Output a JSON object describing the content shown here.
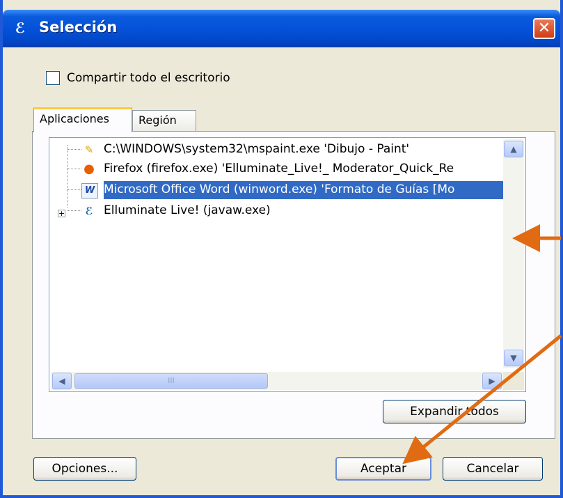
{
  "window": {
    "title": "Selección",
    "close_glyph": "✕"
  },
  "share_desktop": {
    "label": "Compartir todo el escritorio",
    "checked": false
  },
  "tabs": [
    {
      "label": "Aplicaciones",
      "active": true
    },
    {
      "label": "Región",
      "active": false
    }
  ],
  "tree": {
    "items": [
      {
        "label": "C:\\WINDOWS\\system32\\mspaint.exe 'Dibujo - Paint'",
        "icon": "paint-icon",
        "selected": false
      },
      {
        "label": "Firefox (firefox.exe) 'Elluminate_Live!_ Moderator_Quick_Re",
        "icon": "firefox-icon",
        "selected": false
      },
      {
        "label": "Microsoft Office Word (winword.exe) 'Formato de Guías [Mo",
        "icon": "word-icon",
        "selected": true
      },
      {
        "label": "Elluminate Live! (javaw.exe)",
        "icon": "elluminate-icon",
        "selected": false,
        "expandable": true
      }
    ],
    "scrollbar_thumb_grip": "III"
  },
  "buttons": {
    "expand_all": "Expandir todos",
    "options": "Opciones...",
    "accept": "Aceptar",
    "cancel": "Cancelar"
  },
  "colors": {
    "titlebar": "#0552d9",
    "selection": "#316ac5",
    "annotation_arrow": "#e06b12"
  }
}
